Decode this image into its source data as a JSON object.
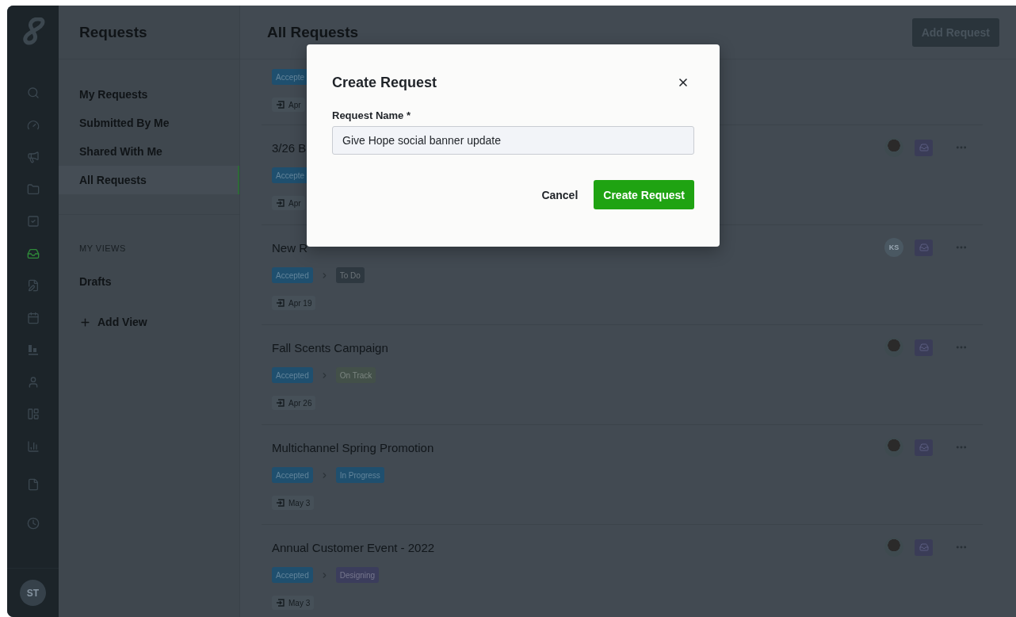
{
  "rail": {
    "items": [
      {
        "kind": "search",
        "selected": false
      },
      {
        "kind": "gauge",
        "selected": false
      },
      {
        "kind": "megaphone",
        "selected": false
      },
      {
        "kind": "folder",
        "selected": false
      },
      {
        "kind": "checkbox",
        "selected": false
      },
      {
        "kind": "inbox",
        "selected": true
      },
      {
        "kind": "file-edit",
        "selected": false
      },
      {
        "kind": "calendar",
        "selected": false
      },
      {
        "kind": "board",
        "selected": false
      },
      {
        "kind": "user",
        "selected": false
      },
      {
        "kind": "layout",
        "selected": false
      },
      {
        "kind": "chart",
        "selected": false
      },
      {
        "kind": "file",
        "selected": false
      },
      {
        "kind": "clock",
        "selected": false
      }
    ],
    "avatar": "ST"
  },
  "sidebar": {
    "title": "Requests",
    "items": [
      {
        "label": "My Requests",
        "selected": false
      },
      {
        "label": "Submitted By Me",
        "selected": false
      },
      {
        "label": "Shared With Me",
        "selected": false
      },
      {
        "label": "All Requests",
        "selected": true
      }
    ],
    "views_heading": "MY VIEWS",
    "views": [
      {
        "label": "Drafts"
      }
    ],
    "add_view": "Add View"
  },
  "main": {
    "title": "All Requests",
    "add_button": "Add Request",
    "rows": [
      {
        "tags": [
          {
            "label": "Accepte",
            "color": "#1f4f6e"
          }
        ],
        "date": "Apr"
      },
      {
        "title": "3/26 B",
        "tags": [
          {
            "label": "Accepte",
            "color": "#1f4f6e"
          }
        ],
        "date": "Apr",
        "avatar": {
          "kind": "photo"
        }
      },
      {
        "title": "New R",
        "tags": [
          {
            "label": "Accepted",
            "color": "#1f4f6e"
          },
          {
            "label": "To Do",
            "color": "#2e3840"
          }
        ],
        "date": "Apr 19",
        "avatar": {
          "kind": "initials",
          "text": "KS"
        }
      },
      {
        "title": "Fall Scents Campaign",
        "tags": [
          {
            "label": "Accepted",
            "color": "#1f4f6e"
          },
          {
            "label": "On Track",
            "color": "#435049"
          }
        ],
        "date": "Apr 26",
        "avatar": {
          "kind": "photo"
        }
      },
      {
        "title": "Multichannel Spring Promotion",
        "tags": [
          {
            "label": "Accepted",
            "color": "#1f4f6e"
          },
          {
            "label": "In Progress",
            "color": "#1f4f6e"
          }
        ],
        "date": "May 3",
        "avatar": {
          "kind": "photo"
        }
      },
      {
        "title": "Annual Customer Event - 2022",
        "tags": [
          {
            "label": "Accepted",
            "color": "#1f4f6e"
          },
          {
            "label": "Designing",
            "color": "#3b3d5c"
          }
        ],
        "date": "May 3",
        "avatar": {
          "kind": "photo"
        }
      }
    ]
  },
  "modal": {
    "title": "Create Request",
    "field_label": "Request Name *",
    "field_value": "Give Hope social banner update",
    "cancel": "Cancel",
    "submit": "Create Request"
  }
}
